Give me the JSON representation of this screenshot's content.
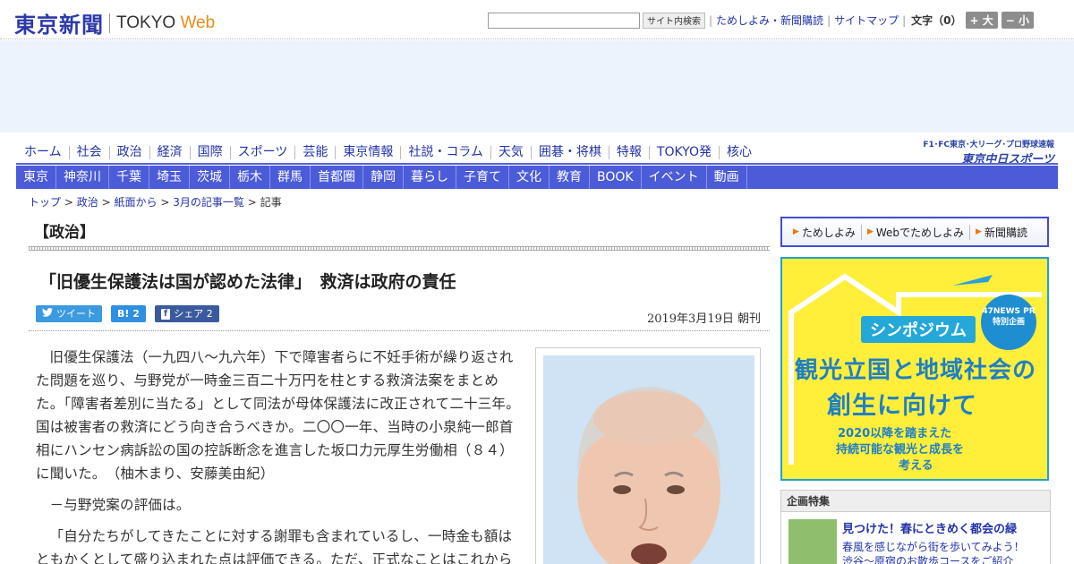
{
  "header": {
    "logo_jp": "東京新聞",
    "logo_en": "TOKYO",
    "logo_web": "Web",
    "search_placeholder": "",
    "search_button": "サイト内検索",
    "links": [
      "ためしよみ・新聞購読",
      "サイトマップ"
    ],
    "font_size_label": "文字（0）",
    "font_bigger": "+ 大",
    "font_smaller": "− 小"
  },
  "nav_primary": [
    "ホーム",
    "社会",
    "政治",
    "経済",
    "国際",
    "スポーツ",
    "芸能",
    "東京情報",
    "社説・コラム",
    "天気",
    "囲碁・将棋",
    "特報",
    "TOKYO発",
    "核心"
  ],
  "chunichi": {
    "small": "F1･FC東京･大リーグ･プロ野球速報",
    "big": "東京中日スポーツ"
  },
  "nav_regional": [
    "東京",
    "神奈川",
    "千葉",
    "埼玉",
    "茨城",
    "栃木",
    "群馬",
    "首都圏",
    "静岡",
    "暮らし",
    "子育て",
    "文化",
    "教育",
    "BOOK",
    "イベント",
    "動画"
  ],
  "breadcrumb": {
    "items": [
      "トップ",
      "政治",
      "紙面から",
      "3月の記事一覧"
    ],
    "current": "記事",
    "separator": ">"
  },
  "section_title": "【政治】",
  "article": {
    "headline": "「旧優生保護法は国が認めた法律」　救済は政府の責任",
    "tweet_label": "ツイート",
    "hatena_label": "B! 2",
    "facebook_label": "シェア 2",
    "date": "2019年3月19日 朝刊",
    "paragraphs": [
      "旧優生保護法（一九四八～九六年）下で障害者らに不妊手術が繰り返された問題を巡り、与野党が一時金三百二十万円を柱とする救済法案をまとめた。「障害者差別に当たる」として同法が母体保護法に改正されて二十三年。国は被害者の救済にどう向き合うべきか。二〇〇一年、当時の小泉純一郎首相にハンセン病訴訟の国の控訴断念を進言した坂口力元厚生労働相（８４）に聞いた。　（柚木まり、安藤美由紀）",
      "－与野党案の評価は。",
      "「自分たちがしてきたことに対する謝罪も含まれているし、一時金も額はともかくとして盛り込まれた点は評価できる。ただ、正式なことはこれから"
    ]
  },
  "sidebar": {
    "promo_links": [
      "ためしよみ",
      "Webでためしよみ",
      "新聞購読"
    ],
    "banner": {
      "tag": "シンポジウム",
      "badge": "47NEWS PR 特別企画",
      "title_line1": "観光立国と地域社会の",
      "title_line2": "創生に向けて",
      "sub1": "2020以降を踏まえた",
      "sub2": "持続可能な観光と成長を",
      "sub3": "考える"
    },
    "feature": {
      "heading": "企画特集",
      "title": "見つけた！春にときめく都会の緑",
      "desc_line1": "春風を感じながら街を歩いてみよう！",
      "desc_line2": "渋谷～原宿のお散歩コースをご紹介"
    }
  },
  "colors": {
    "brand_blue": "#2c3aa8",
    "nav_bar": "#4c5bd8",
    "link": "#2233aa",
    "web_orange": "#e88d12",
    "banner_yellow": "#ffef3b",
    "banner_blue": "#1f7fc6"
  }
}
